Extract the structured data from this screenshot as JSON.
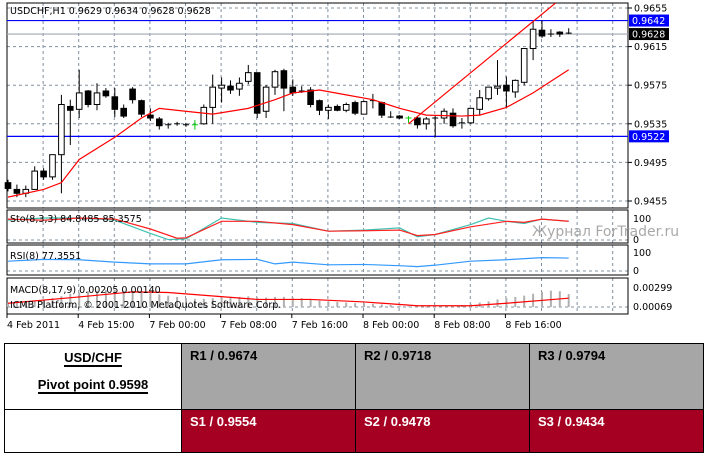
{
  "chart": {
    "header": "USDCHF,H1  0.9629 0.9634 0.9628 0.9628",
    "price_labels": [
      "0.9655",
      "0.9615",
      "0.9575",
      "0.9535",
      "0.9495",
      "0.9455"
    ],
    "price_levels": [
      0.9655,
      0.9615,
      0.9575,
      0.9535,
      0.9495,
      0.9455
    ],
    "level_lines": [
      {
        "label": "0.9642",
        "price": 0.9642,
        "color": "#0000ff"
      },
      {
        "label": "0.9628",
        "price": 0.9628,
        "color": "#000000"
      },
      {
        "label": "0.9522",
        "price": 0.9522,
        "color": "#0000ff"
      }
    ],
    "date_labels": [
      "4 Feb 2011",
      "4 Feb 15:00",
      "7 Feb 00:00",
      "7 Feb 08:00",
      "7 Feb 16:00",
      "8 Feb 00:00",
      "8 Feb 08:00",
      "8 Feb 16:00"
    ],
    "watermark": "Журнал ForTrader.ru",
    "colors": {
      "ma": "#ff0000",
      "trend": "#ff0000",
      "grid": "#8090a0",
      "bull_doji": "#00cc00"
    }
  },
  "chart_data": {
    "type": "candlestick",
    "symbol": "USDCHF",
    "timeframe": "H1",
    "ylim": [
      0.945,
      0.966
    ],
    "candles": [
      [
        0.9474,
        0.9477,
        0.9465,
        0.9468
      ],
      [
        0.9467,
        0.9472,
        0.9459,
        0.9463
      ],
      [
        0.9463,
        0.9471,
        0.9459,
        0.9467
      ],
      [
        0.9467,
        0.9491,
        0.9467,
        0.9486
      ],
      [
        0.9486,
        0.9489,
        0.9477,
        0.948
      ],
      [
        0.948,
        0.9503,
        0.9477,
        0.9503
      ],
      [
        0.9503,
        0.9565,
        0.9463,
        0.9555
      ],
      [
        0.9553,
        0.956,
        0.9513,
        0.9549
      ],
      [
        0.955,
        0.9591,
        0.9541,
        0.9567
      ],
      [
        0.9569,
        0.957,
        0.9552,
        0.9555
      ],
      [
        0.9555,
        0.9577,
        0.9549,
        0.9567
      ],
      [
        0.9569,
        0.9572,
        0.9562,
        0.9564
      ],
      [
        0.9563,
        0.9572,
        0.9542,
        0.955
      ],
      [
        0.9551,
        0.9555,
        0.9541,
        0.9543
      ],
      [
        0.9571,
        0.9573,
        0.9556,
        0.956
      ],
      [
        0.9559,
        0.956,
        0.9542,
        0.9545
      ],
      [
        0.9544,
        0.9551,
        0.9538,
        0.9541
      ],
      [
        0.954,
        0.9542,
        0.9529,
        0.9533
      ],
      [
        0.9534,
        0.9536,
        0.953,
        0.9534
      ],
      [
        0.9535,
        0.9537,
        0.9533,
        0.9535
      ],
      [
        0.9534,
        0.9536,
        0.9532,
        0.9534
      ],
      [
        0.9534,
        0.9539,
        0.9529,
        0.9534
      ],
      [
        0.9535,
        0.9555,
        0.9534,
        0.9552
      ],
      [
        0.9552,
        0.9586,
        0.9535,
        0.9573
      ],
      [
        0.9572,
        0.9583,
        0.9557,
        0.9575
      ],
      [
        0.9574,
        0.958,
        0.9566,
        0.957
      ],
      [
        0.9571,
        0.9583,
        0.9564,
        0.9577
      ],
      [
        0.9579,
        0.9596,
        0.9576,
        0.9588
      ],
      [
        0.9588,
        0.9588,
        0.9541,
        0.9546
      ],
      [
        0.9548,
        0.9575,
        0.9541,
        0.9573
      ],
      [
        0.9573,
        0.9591,
        0.9565,
        0.9589
      ],
      [
        0.959,
        0.9592,
        0.9548,
        0.9572
      ],
      [
        0.9573,
        0.9581,
        0.9564,
        0.9567
      ],
      [
        0.9569,
        0.9574,
        0.9567,
        0.9569
      ],
      [
        0.957,
        0.9573,
        0.9552,
        0.9555
      ],
      [
        0.9559,
        0.956,
        0.9544,
        0.9549
      ],
      [
        0.9549,
        0.9555,
        0.954,
        0.9552
      ],
      [
        0.9553,
        0.9555,
        0.9548,
        0.9549
      ],
      [
        0.9549,
        0.9557,
        0.9547,
        0.9555
      ],
      [
        0.9557,
        0.9559,
        0.9544,
        0.9546
      ],
      [
        0.9545,
        0.9559,
        0.9545,
        0.9558
      ],
      [
        0.9559,
        0.9566,
        0.9551,
        0.9559
      ],
      [
        0.9557,
        0.9558,
        0.9541,
        0.9544
      ],
      [
        0.9542,
        0.9548,
        0.9541,
        0.9542
      ],
      [
        0.9543,
        0.9544,
        0.954,
        0.9541
      ],
      [
        0.9541,
        0.9543,
        0.9536,
        0.9541
      ],
      [
        0.9541,
        0.9543,
        0.953,
        0.9534
      ],
      [
        0.9535,
        0.9542,
        0.9529,
        0.954
      ],
      [
        0.9541,
        0.9543,
        0.9521,
        0.9541
      ],
      [
        0.9541,
        0.9551,
        0.9535,
        0.9548
      ],
      [
        0.9546,
        0.9551,
        0.9531,
        0.9533
      ],
      [
        0.9536,
        0.9541,
        0.953,
        0.9536
      ],
      [
        0.9536,
        0.9551,
        0.9535,
        0.9551
      ],
      [
        0.955,
        0.957,
        0.9544,
        0.9562
      ],
      [
        0.9561,
        0.9573,
        0.9559,
        0.9573
      ],
      [
        0.9572,
        0.9601,
        0.9565,
        0.9574
      ],
      [
        0.9575,
        0.9584,
        0.9551,
        0.9569
      ],
      [
        0.9568,
        0.9581,
        0.9562,
        0.958
      ],
      [
        0.9578,
        0.9613,
        0.9575,
        0.9613
      ],
      [
        0.9613,
        0.9641,
        0.9601,
        0.9633
      ],
      [
        0.9632,
        0.9642,
        0.9624,
        0.9626
      ],
      [
        0.9628,
        0.9633,
        0.9625,
        0.9628
      ],
      [
        0.963,
        0.9631,
        0.9625,
        0.9628
      ],
      [
        0.9629,
        0.9634,
        0.9628,
        0.9628
      ]
    ],
    "green_doji_bars": [
      21,
      45
    ],
    "ma": [
      [
        0,
        0.9459
      ],
      [
        4,
        0.9467
      ],
      [
        6,
        0.9474
      ],
      [
        8,
        0.9498
      ],
      [
        12,
        0.9521
      ],
      [
        15,
        0.9541
      ],
      [
        17,
        0.9551
      ],
      [
        21,
        0.9547
      ],
      [
        23,
        0.9545
      ],
      [
        27,
        0.9551
      ],
      [
        30,
        0.956
      ],
      [
        32,
        0.9567
      ],
      [
        35,
        0.957
      ],
      [
        38,
        0.9565
      ],
      [
        41,
        0.956
      ],
      [
        44,
        0.9551
      ],
      [
        47,
        0.9544
      ],
      [
        51,
        0.9543
      ],
      [
        53,
        0.9544
      ],
      [
        56,
        0.9552
      ],
      [
        59,
        0.9567
      ],
      [
        62,
        0.9585
      ],
      [
        63,
        0.9591
      ]
    ],
    "trendline": [
      [
        45,
        0.9535
      ],
      [
        61.5,
        0.966
      ]
    ],
    "indicators": {
      "sto": {
        "label": "Sto(8,3,3) 84.8485 85.3575",
        "axis_labels": [
          "100",
          "0"
        ],
        "main": [
          [
            0,
            90
          ],
          [
            4,
            100
          ],
          [
            8,
            100
          ],
          [
            12,
            90
          ],
          [
            16,
            30
          ],
          [
            18,
            2
          ],
          [
            20,
            5
          ],
          [
            24,
            100
          ],
          [
            28,
            80
          ],
          [
            32,
            75
          ],
          [
            36,
            40
          ],
          [
            40,
            45
          ],
          [
            44,
            55
          ],
          [
            46,
            15
          ],
          [
            48,
            25
          ],
          [
            52,
            70
          ],
          [
            54,
            100
          ],
          [
            56,
            85
          ],
          [
            58,
            75
          ],
          [
            60,
            95
          ],
          [
            63,
            84.8485
          ]
        ],
        "signal": [
          [
            0,
            95
          ],
          [
            4,
            90
          ],
          [
            8,
            100
          ],
          [
            12,
            95
          ],
          [
            16,
            50
          ],
          [
            19,
            8
          ],
          [
            20,
            10
          ],
          [
            24,
            85
          ],
          [
            28,
            85
          ],
          [
            32,
            70
          ],
          [
            36,
            40
          ],
          [
            40,
            42
          ],
          [
            44,
            45
          ],
          [
            46,
            20
          ],
          [
            48,
            25
          ],
          [
            52,
            60
          ],
          [
            56,
            85
          ],
          [
            58,
            80
          ],
          [
            60,
            95
          ],
          [
            63,
            85.3575
          ]
        ]
      },
      "rsi": {
        "label": "RSI(8) 77.3551",
        "axis_labels": [
          "100",
          "0"
        ],
        "values": [
          [
            0,
            60
          ],
          [
            4,
            70
          ],
          [
            8,
            68
          ],
          [
            12,
            55
          ],
          [
            16,
            45
          ],
          [
            20,
            45
          ],
          [
            24,
            68
          ],
          [
            28,
            70
          ],
          [
            30,
            45
          ],
          [
            32,
            55
          ],
          [
            36,
            40
          ],
          [
            40,
            42
          ],
          [
            44,
            35
          ],
          [
            46,
            30
          ],
          [
            48,
            38
          ],
          [
            52,
            60
          ],
          [
            56,
            68
          ],
          [
            60,
            80
          ],
          [
            63,
            77.3551
          ]
        ]
      },
      "macd": {
        "label": "MACD(8,17,9) 0.00205 0.00140",
        "axis_labels": [
          "0.00299",
          "0.00069"
        ],
        "histogram": [
          0.0006,
          0.0007,
          0.0008,
          0.001,
          0.0012,
          0.0014,
          0.0017,
          0.0021,
          0.0023,
          0.0025,
          0.0026,
          0.0027,
          0.0027,
          0.0026,
          0.0025,
          0.0024,
          0.0022,
          0.002,
          0.0018,
          0.0016,
          0.0014,
          0.0013,
          0.0013,
          0.0014,
          0.0015,
          0.0016,
          0.0016,
          0.0017,
          0.0015,
          0.0015,
          0.0016,
          0.0016,
          0.0015,
          0.0014,
          0.0012,
          0.001,
          0.0009,
          0.0008,
          0.0007,
          0.0006,
          0.0006,
          0.0005,
          0.0004,
          0.0003,
          0.0002,
          0.0001,
          0.0,
          -0.0001,
          -0.0001,
          0.0,
          0.0002,
          0.0003,
          0.0005,
          0.0007,
          0.0009,
          0.0012,
          0.0014,
          0.0016,
          0.0018,
          0.0021,
          0.0024,
          0.0026,
          0.0025,
          0.00205
        ],
        "signal": [
          [
            0,
            0.0006
          ],
          [
            8,
            0.0016
          ],
          [
            14,
            0.0024
          ],
          [
            18,
            0.0023
          ],
          [
            28,
            0.0012
          ],
          [
            34,
            0.0012
          ],
          [
            40,
            0.0008
          ],
          [
            46,
            0.0002
          ],
          [
            52,
            0.0002
          ],
          [
            56,
            0.0006
          ],
          [
            63,
            0.0014
          ]
        ]
      },
      "copyright": "ICMB Platform, © 2001-2010 MetaQuotes Software Corp."
    }
  },
  "pivot_table": {
    "pair": "USD/CHF",
    "pivot": "Pivot point 0.9598",
    "resistance": [
      "R1 / 0.9674",
      "R2 / 0.9718",
      "R3 / 0.9794"
    ],
    "support": [
      "S1 / 0.9554",
      "S2 / 0.9478",
      "S3 / 0.9434"
    ],
    "colors": {
      "resistance_bg": "#a6a6a6",
      "support_bg": "#a50021"
    }
  }
}
